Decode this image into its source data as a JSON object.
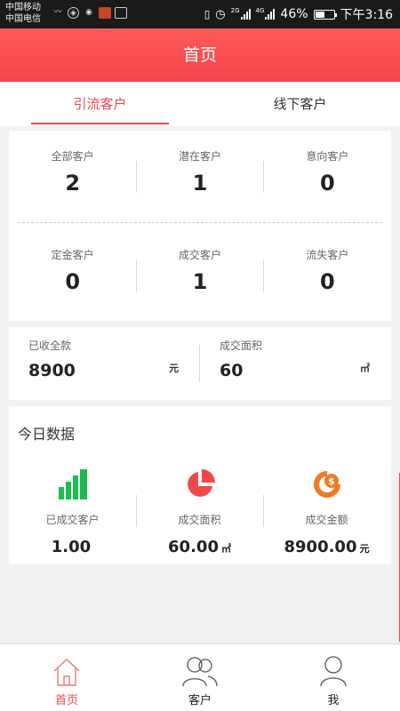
{
  "status_bar": {
    "carrier_1": "中国移动",
    "carrier_2": "中国电信",
    "network_2g": "2G",
    "network_4g": "4G",
    "battery": "46%",
    "time": "下午3:16"
  },
  "header": {
    "title": "首页"
  },
  "tabs": [
    {
      "label": "引流客户",
      "active": true
    },
    {
      "label": "线下客户",
      "active": false
    }
  ],
  "customer_stats": {
    "row1": [
      {
        "label": "全部客户",
        "value": "2"
      },
      {
        "label": "潜在客户",
        "value": "1"
      },
      {
        "label": "意向客户",
        "value": "0"
      }
    ],
    "row2": [
      {
        "label": "定金客户",
        "value": "0"
      },
      {
        "label": "成交客户",
        "value": "1"
      },
      {
        "label": "流失客户",
        "value": "0"
      }
    ]
  },
  "money": {
    "received": {
      "label": "已收全款",
      "value": "8900",
      "unit": "元"
    },
    "area": {
      "label": "成交面积",
      "value": "60",
      "unit": "㎡"
    }
  },
  "today": {
    "title": "今日数据",
    "items": [
      {
        "label": "已成交客户",
        "value": "1.00",
        "unit": "",
        "icon": "bar-chart-icon",
        "color": "#1dbb4f"
      },
      {
        "label": "成交面积",
        "value": "60.00",
        "unit": "㎡",
        "icon": "pie-chart-icon",
        "color": "#f04848"
      },
      {
        "label": "成交金额",
        "value": "8900.00",
        "unit": "元",
        "icon": "money-icon",
        "color": "#ef7a22"
      }
    ]
  },
  "bottom_nav": [
    {
      "label": "首页",
      "icon": "home-icon",
      "active": true
    },
    {
      "label": "客户",
      "icon": "customers-icon",
      "active": false
    },
    {
      "label": "我",
      "icon": "profile-icon",
      "active": false
    }
  ],
  "colors": {
    "accent": "#e84a4a",
    "header": "#f5454c"
  }
}
